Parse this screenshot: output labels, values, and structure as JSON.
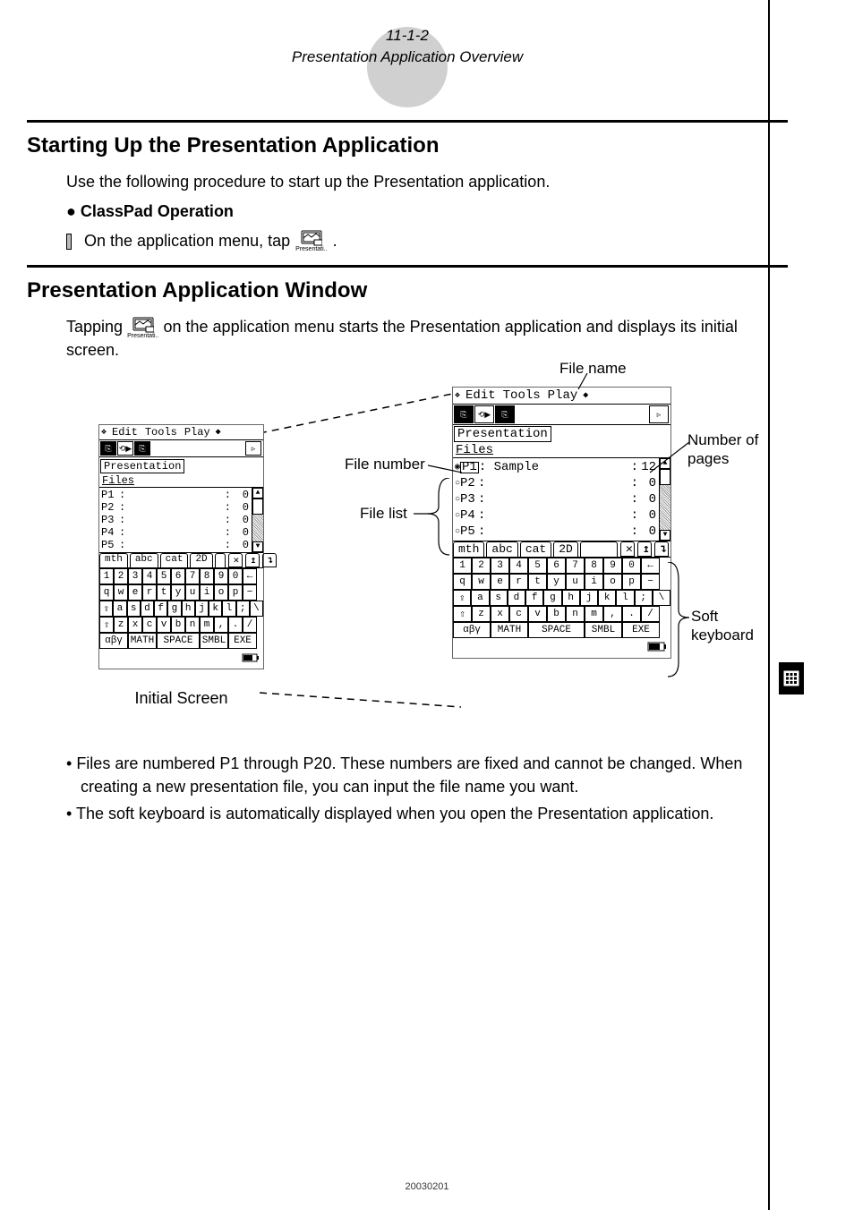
{
  "header": {
    "ref": "11-1-2",
    "subtitle": "Presentation Application Overview"
  },
  "section1": {
    "heading": "Starting Up the Presentation Application",
    "intro": "Use the following procedure to start up the Presentation application.",
    "sub": "ClassPad Operation",
    "step_prefix": "On the application menu, tap ",
    "step_suffix": ".",
    "icon_label": "Presentati.."
  },
  "section2": {
    "heading": "Presentation Application Window",
    "text_a": "Tapping ",
    "text_b": " on the application menu starts the Presentation application and displays its initial screen.",
    "icon_label": "Presentati.."
  },
  "callouts": {
    "file_number": "File number",
    "file_list": "File list",
    "file_name": "File name",
    "num_pages_l1": "Number of",
    "num_pages_l2": "pages",
    "soft_l1": "Soft",
    "soft_l2": "keyboard",
    "initial_screen": "Initial Screen"
  },
  "device": {
    "menu": {
      "m1": "Edit",
      "m2": "Tools",
      "m3": "Play",
      "v_icon": "❖",
      "diamond": "◆"
    },
    "title_box": "Presentation",
    "files_label": "Files",
    "small_screen": {
      "rows": [
        {
          "p": "P1",
          "name": "",
          "count": "0"
        },
        {
          "p": "P2",
          "name": "",
          "count": "0"
        },
        {
          "p": "P3",
          "name": "",
          "count": "0"
        },
        {
          "p": "P4",
          "name": "",
          "count": "0"
        },
        {
          "p": "P5",
          "name": "",
          "count": "0"
        }
      ]
    },
    "large_screen": {
      "rows": [
        {
          "p": "P1",
          "name": "Sample",
          "count": "12",
          "selected": true
        },
        {
          "p": "P2",
          "name": "",
          "count": "0"
        },
        {
          "p": "P3",
          "name": "",
          "count": "0"
        },
        {
          "p": "P4",
          "name": "",
          "count": "0"
        },
        {
          "p": "P5",
          "name": "",
          "count": "0"
        }
      ]
    },
    "kbd_tabs": {
      "t1": "mth",
      "t2": "abc",
      "t3": "cat",
      "t4": "2D",
      "bx1": "✕",
      "bx2": "↥",
      "bx3": "↴"
    },
    "kbd_rows": {
      "r1": [
        "1",
        "2",
        "3",
        "4",
        "5",
        "6",
        "7",
        "8",
        "9",
        "0",
        "←"
      ],
      "r2": [
        "q",
        "w",
        "e",
        "r",
        "t",
        "y",
        "u",
        "i",
        "o",
        "p",
        "−"
      ],
      "r3": [
        "⇪",
        "a",
        "s",
        "d",
        "f",
        "g",
        "h",
        "j",
        "k",
        "l",
        ";",
        "\\"
      ],
      "r4": [
        "⇧",
        "z",
        "x",
        "c",
        "v",
        "b",
        "n",
        "m",
        ",",
        ".",
        "/"
      ],
      "r5": [
        "αβγ",
        "MATH",
        "SPACE",
        "SMBL",
        "EXE"
      ]
    }
  },
  "notes": {
    "n1": "Files are numbered P1 through P20. These numbers are fixed and cannot be changed. When creating a new presentation file, you can input the file name you want.",
    "n2": "The soft keyboard is automatically displayed when you open the Presentation application."
  },
  "footer": "20030201"
}
